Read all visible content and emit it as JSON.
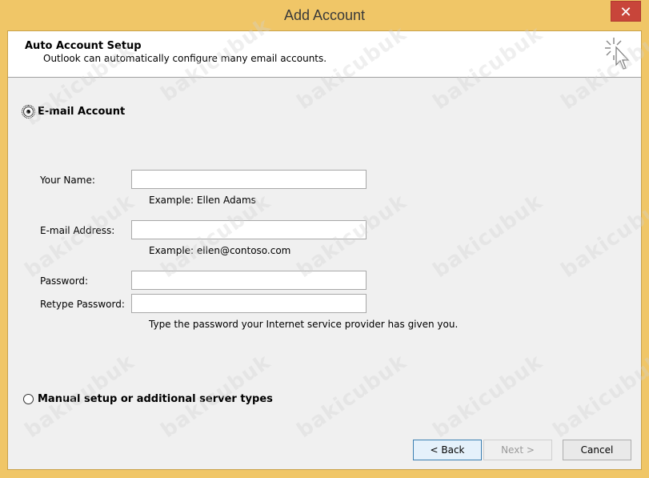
{
  "window": {
    "title": "Add Account",
    "close_symbol": "✕"
  },
  "header": {
    "title": "Auto Account Setup",
    "subtitle": "Outlook can automatically configure many email accounts.",
    "icon": "cursor-sparkle-icon"
  },
  "email_option": {
    "label": "E-mail Account",
    "selected": true
  },
  "form": {
    "name_label": "Your Name:",
    "name_value": "",
    "name_hint": "Example: Ellen Adams",
    "email_label": "E-mail Address:",
    "email_value": "",
    "email_hint": "Example: ellen@contoso.com",
    "password_label": "Password:",
    "password_value": "",
    "retype_label": "Retype Password:",
    "retype_value": "",
    "password_hint": "Type the password your Internet service provider has given you."
  },
  "manual_option": {
    "label": "Manual setup or additional server types",
    "selected": false
  },
  "buttons": {
    "back": "< Back",
    "next": "Next >",
    "cancel": "Cancel"
  },
  "watermark": "bakicubuk",
  "colors": {
    "frame": "#f0c667",
    "close": "#c8453a",
    "default_button_border": "#3c7fb1"
  }
}
